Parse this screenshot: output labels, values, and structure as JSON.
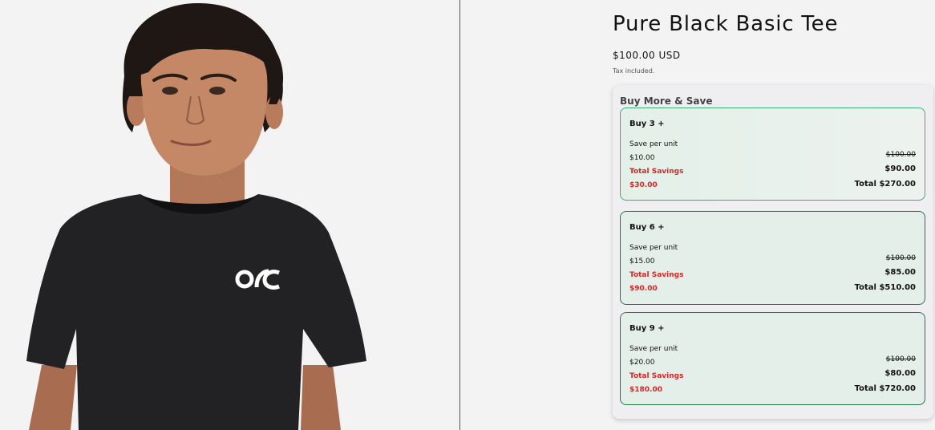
{
  "product": {
    "title": "Pure Black Basic Tee",
    "price": "$100.00 USD",
    "tax_note": "Tax included.",
    "image_logo_text": "OSC"
  },
  "bundle_widget": {
    "heading": "Buy More & Save",
    "tiers": [
      {
        "label": "Buy 3 +",
        "save_per_unit_label": "Save per unit",
        "save_per_unit": "$10.00",
        "total_savings_label": "Total Savings",
        "total_savings": "$30.00",
        "original_price": "$100.00",
        "unit_price": "$90.00",
        "total": "Total $270.00"
      },
      {
        "label": "Buy 6 +",
        "save_per_unit_label": "Save per unit",
        "save_per_unit": "$15.00",
        "total_savings_label": "Total Savings",
        "total_savings": "$90.00",
        "original_price": "$100.00",
        "unit_price": "$85.00",
        "total": "Total $510.00"
      },
      {
        "label": "Buy 9 +",
        "save_per_unit_label": "Save per unit",
        "save_per_unit": "$20.00",
        "total_savings_label": "Total Savings",
        "total_savings": "$180.00",
        "original_price": "$100.00",
        "unit_price": "$80.00",
        "total": "Total $720.00"
      }
    ]
  },
  "colors": {
    "page_background": "#f3f3f3",
    "savings_red": "#dc2626",
    "tier_border_selected": "#38b07a",
    "tier_border": "#1f7a46",
    "tier_background": "#e4efe9"
  }
}
